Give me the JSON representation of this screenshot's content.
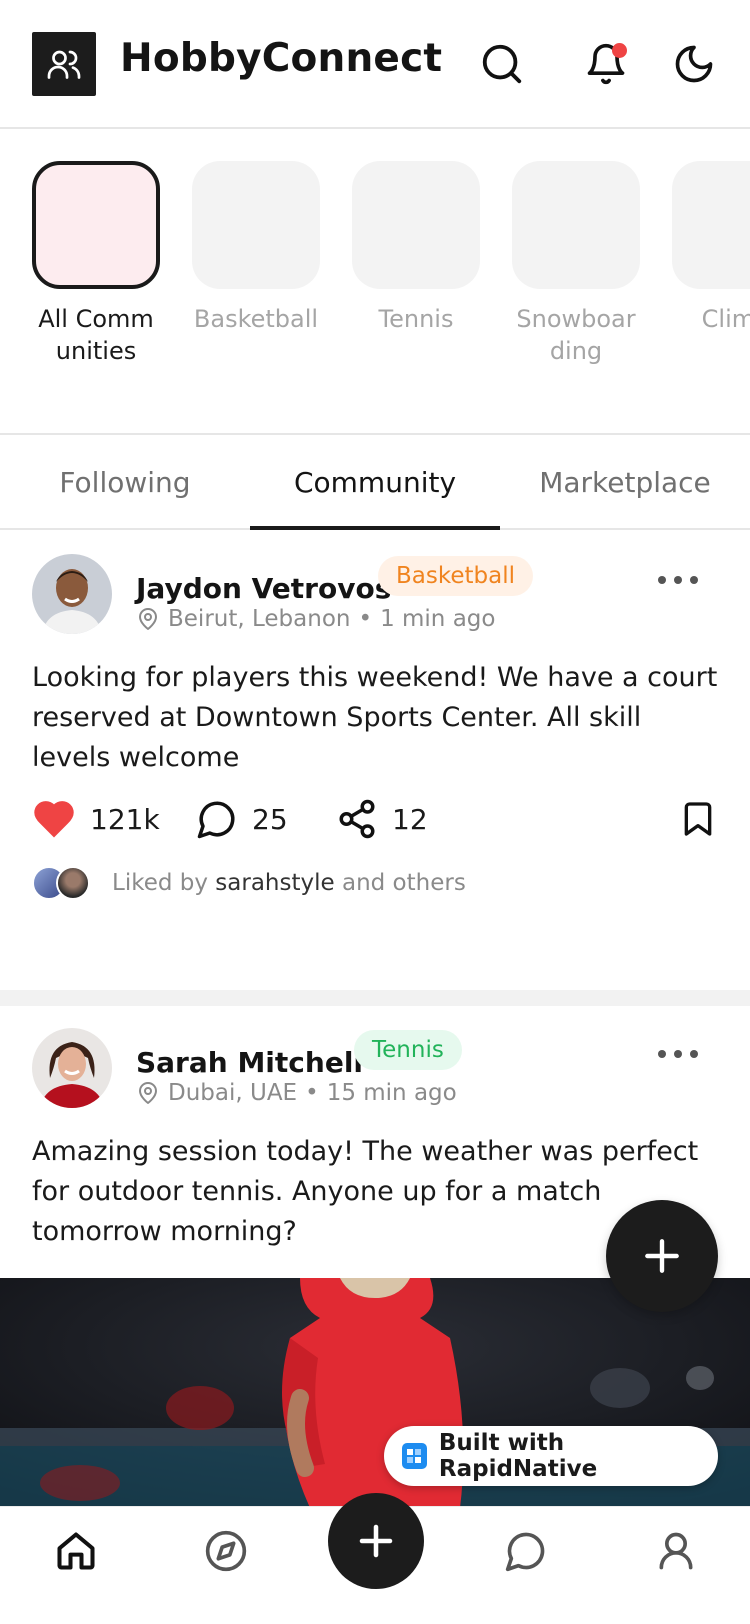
{
  "header": {
    "app_title": "HobbyConnect",
    "icons": [
      "users-icon",
      "search-icon",
      "bell-icon",
      "moon-icon"
    ],
    "has_notification": true
  },
  "communities": [
    {
      "label": "All Communities",
      "active": true
    },
    {
      "label": "Basketball",
      "active": false
    },
    {
      "label": "Tennis",
      "active": false
    },
    {
      "label": "Snowboarding",
      "active": false
    },
    {
      "label": "Climb",
      "active": false
    }
  ],
  "tabs": [
    {
      "label": "Following",
      "active": false
    },
    {
      "label": "Community",
      "active": true
    },
    {
      "label": "Marketplace",
      "active": false
    }
  ],
  "posts": [
    {
      "author": "Jaydon Vetrovos",
      "tag": "Basketball",
      "location": "Beirut, Lebanon",
      "time": "1 min ago",
      "text": "Looking for players this weekend! We have a court reserved at Downtown Sports Center. All skill levels welcome",
      "likes": "121k",
      "comments": "25",
      "shares": "12",
      "liked_by_prefix": "Liked by",
      "liked_by_user": "sarahstyle",
      "liked_by_suffix": "and others"
    },
    {
      "author": "Sarah Mitchell",
      "tag": "Tennis",
      "location": "Dubai, UAE",
      "time": "15 min ago",
      "text": "Amazing session today! The weather was perfect for outdoor tennis. Anyone up for a match tomorrow morning?"
    }
  ],
  "badge": {
    "label": "Built with RapidNative"
  },
  "bottom_nav": [
    "home-icon",
    "compass-icon",
    "chat-icon",
    "profile-icon"
  ],
  "colors": {
    "accent": "#1c1c1c",
    "like": "#ef4444",
    "tag_orange": "#f0841f",
    "tag_green": "#22b35a",
    "notification": "#ef4444"
  }
}
